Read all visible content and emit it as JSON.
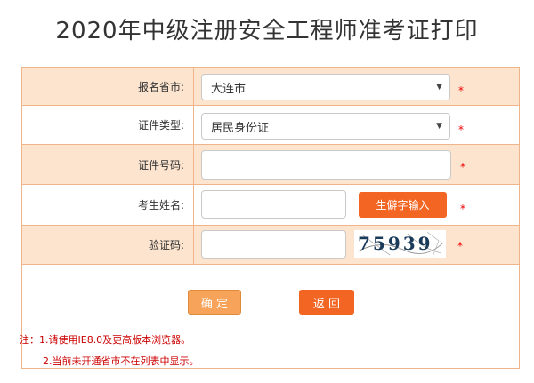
{
  "page_title": "2020年中级注册安全工程师准考证打印",
  "form": {
    "province_label": "报名省市:",
    "province_value": "大连市",
    "id_type_label": "证件类型:",
    "id_type_value": "居民身份证",
    "id_number_label": "证件号码:",
    "id_number_value": "",
    "name_label": "考生姓名:",
    "name_value": "",
    "rare_char_button": "生僻字输入",
    "captcha_label": "验证码:",
    "captcha_value": "",
    "captcha_text": "75939",
    "required_mark": "*"
  },
  "buttons": {
    "confirm": "确 定",
    "back": "返 回"
  },
  "notes": {
    "line1": "注：1.请使用IE8.0及更高版本浏览器。",
    "line2": "2.当前未开通省市不在列表中显示。"
  },
  "colors": {
    "accent": "#f26522",
    "confirm": "#f7a45a",
    "row_tint": "#fce4cf",
    "border": "#f0b48a",
    "note": "#cc0000"
  }
}
